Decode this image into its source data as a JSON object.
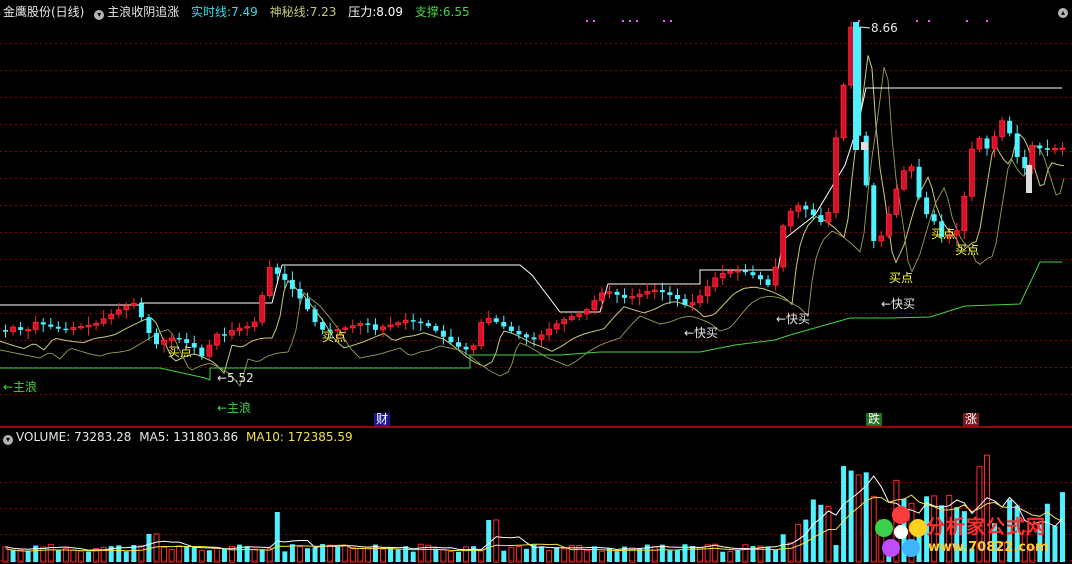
{
  "header": {
    "title": "金鹰股份(日线)",
    "indicator_name": "主浪收阴追涨",
    "params": [
      {
        "label": "实时线:",
        "value": "7.49",
        "color": "#35d8e8"
      },
      {
        "label": "神秘线:",
        "value": "7.23",
        "color": "#c9c97a"
      },
      {
        "label": "压力:",
        "value": "8.09",
        "color": "#ffffff"
      },
      {
        "label": "支撑:",
        "value": "6.55",
        "color": "#44d444"
      }
    ]
  },
  "volume_header": {
    "title": "VOLUME:",
    "value": "73283.28",
    "ma5_label": "MA5:",
    "ma5_value": "131803.86",
    "ma10_label": "MA10:",
    "ma10_value": "172385.59"
  },
  "markers": {
    "main_wave_left": "←主浪",
    "main_wave_low": "←主浪",
    "low_price": "←5.52",
    "high_price": "8.66",
    "buy_point": "买点",
    "fast_buy": "←快买",
    "cai": "财",
    "die": "跌",
    "zhang": "涨"
  },
  "watermark": {
    "text": "分析家公式网",
    "url": "www.70822.com"
  },
  "colors": {
    "up": "#ff2a2a",
    "up_fill": "#d8102e",
    "down": "#4ff0ff",
    "realtime_line": "#35d8e8",
    "mystery_line": "#c9c97a",
    "pressure": "#ffffff",
    "support": "#44d444",
    "grid": "#8b0000",
    "buy": "#ffff33"
  },
  "chart_data": {
    "type": "candlestick",
    "title": "金鹰股份(日线)",
    "price_marks": {
      "high": 8.66,
      "low": 5.52
    },
    "series": [
      {
        "name": "实时线",
        "last": 7.49
      },
      {
        "name": "神秘线",
        "last": 7.23
      },
      {
        "name": "压力",
        "last": 8.09
      },
      {
        "name": "支撑",
        "last": 6.55
      }
    ],
    "volume": {
      "value": 73283.28,
      "ma5": 131803.86,
      "ma10": 172385.59
    }
  }
}
